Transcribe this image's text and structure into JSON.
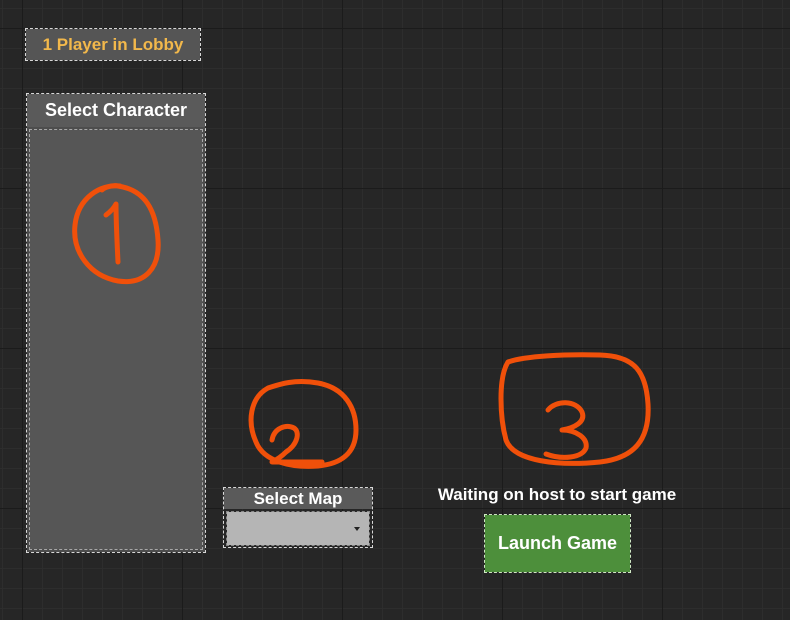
{
  "lobby": {
    "player_count_label": "1 Player in Lobby"
  },
  "character_panel": {
    "header": "Select Character"
  },
  "map_selector": {
    "label": "Select Map",
    "selected_value": ""
  },
  "status": {
    "waiting_text": "Waiting on host to start game"
  },
  "launch": {
    "label": "Launch Game"
  },
  "colors": {
    "lobby_text": "#f2b84b",
    "launch_button": "#4d8f3b",
    "annotation": "#f0500a",
    "panel": "#4d4d4d",
    "background": "#262626"
  }
}
